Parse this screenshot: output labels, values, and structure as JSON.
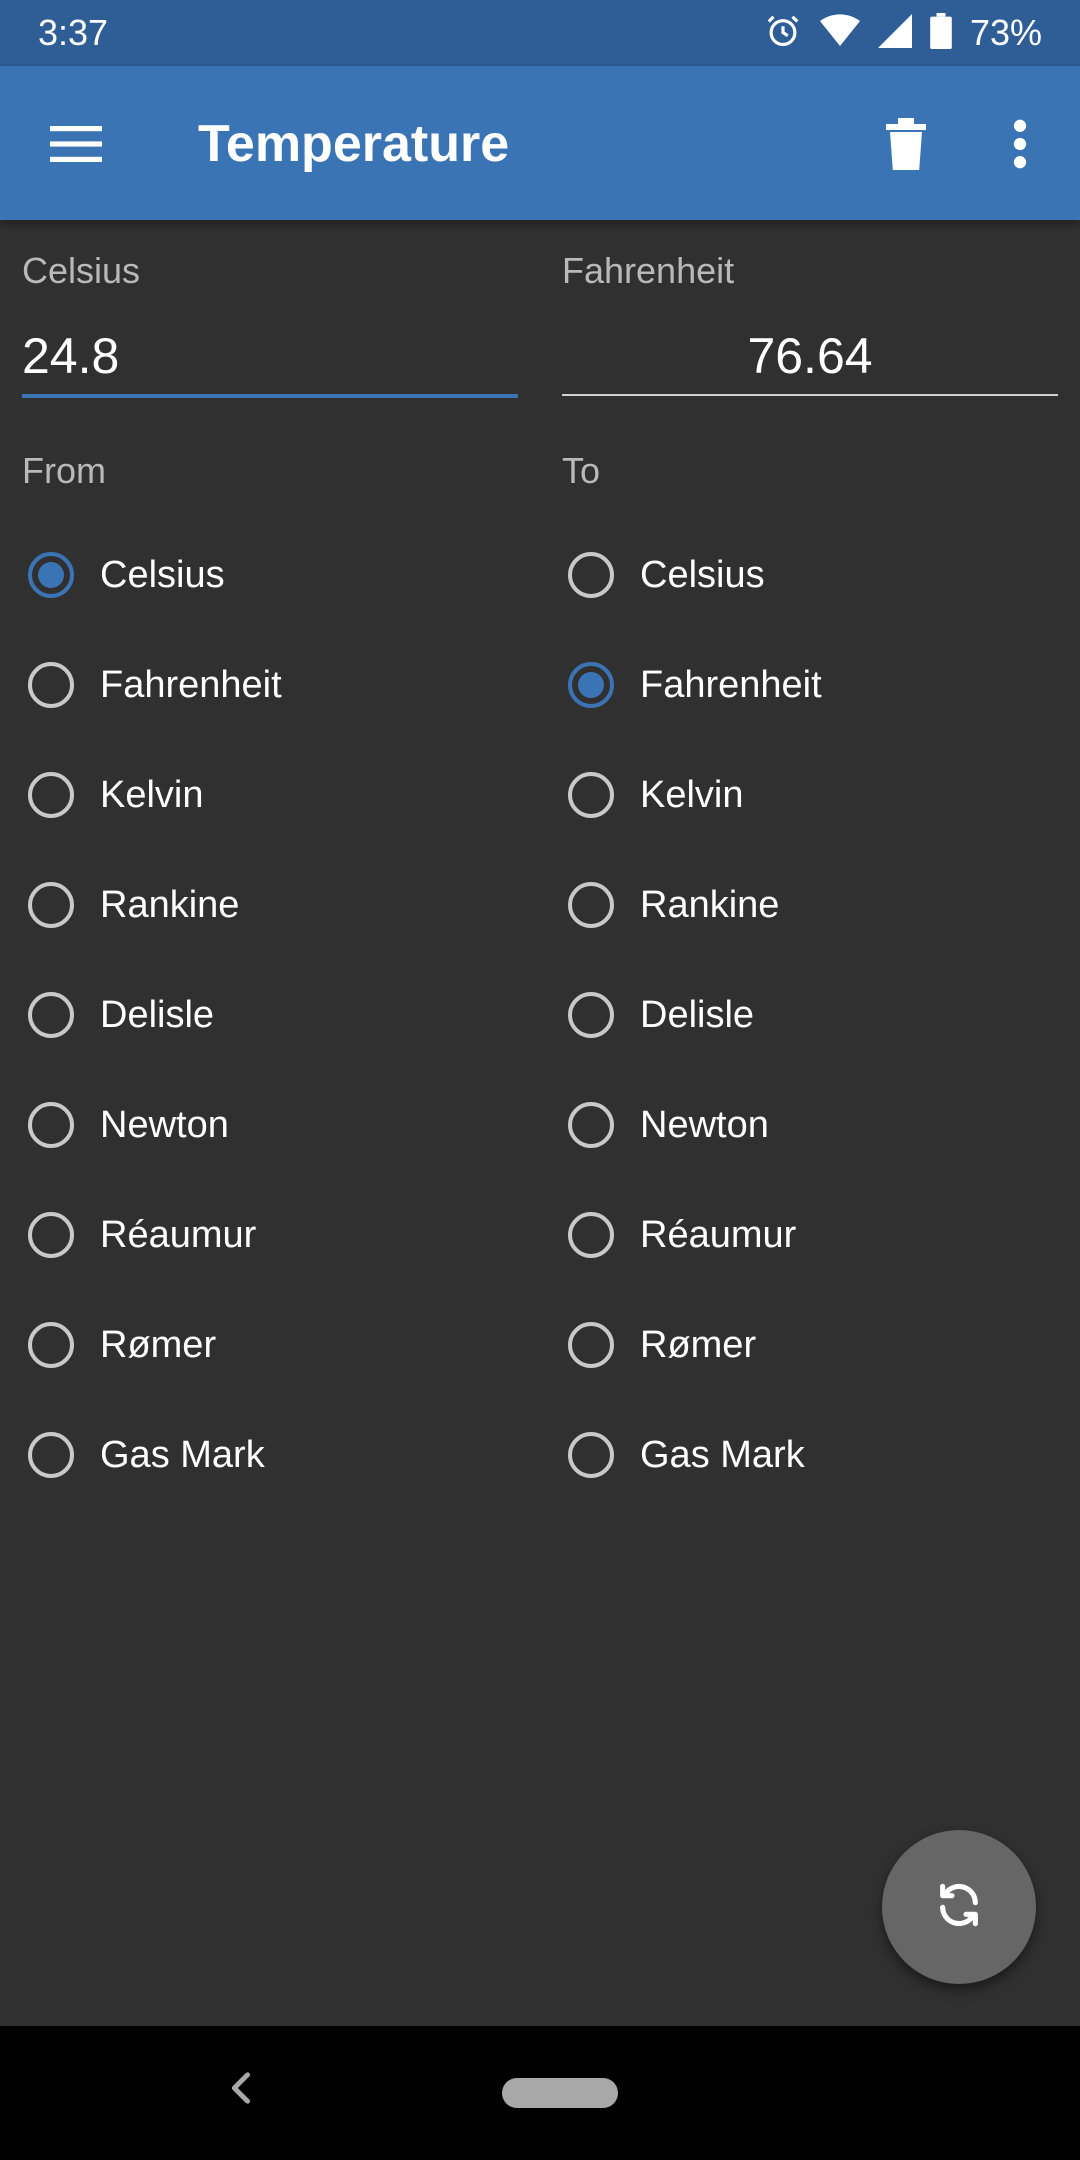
{
  "status_bar": {
    "time": "3:37",
    "battery_percent": "73%",
    "icons": [
      "alarm-icon",
      "wifi-icon",
      "signal-icon",
      "battery-icon"
    ]
  },
  "app_bar": {
    "title": "Temperature",
    "icons": [
      "menu-icon",
      "delete-icon",
      "more-vert-icon"
    ],
    "color": "#3b74b4"
  },
  "from_field": {
    "label": "Celsius",
    "value": "24.8"
  },
  "to_field": {
    "label": "Fahrenheit",
    "value": "76.64"
  },
  "from_group": {
    "label": "From",
    "selected": "Celsius",
    "options": [
      "Celsius",
      "Fahrenheit",
      "Kelvin",
      "Rankine",
      "Delisle",
      "Newton",
      "Réaumur",
      "Rømer",
      "Gas Mark"
    ]
  },
  "to_group": {
    "label": "To",
    "selected": "Fahrenheit",
    "options": [
      "Celsius",
      "Fahrenheit",
      "Kelvin",
      "Rankine",
      "Delisle",
      "Newton",
      "Réaumur",
      "Rømer",
      "Gas Mark"
    ]
  },
  "fab": {
    "icon": "swap-refresh-icon"
  },
  "colors": {
    "accent": "#3b74b4",
    "background": "#303030",
    "status_bar": "#2f5d95"
  }
}
